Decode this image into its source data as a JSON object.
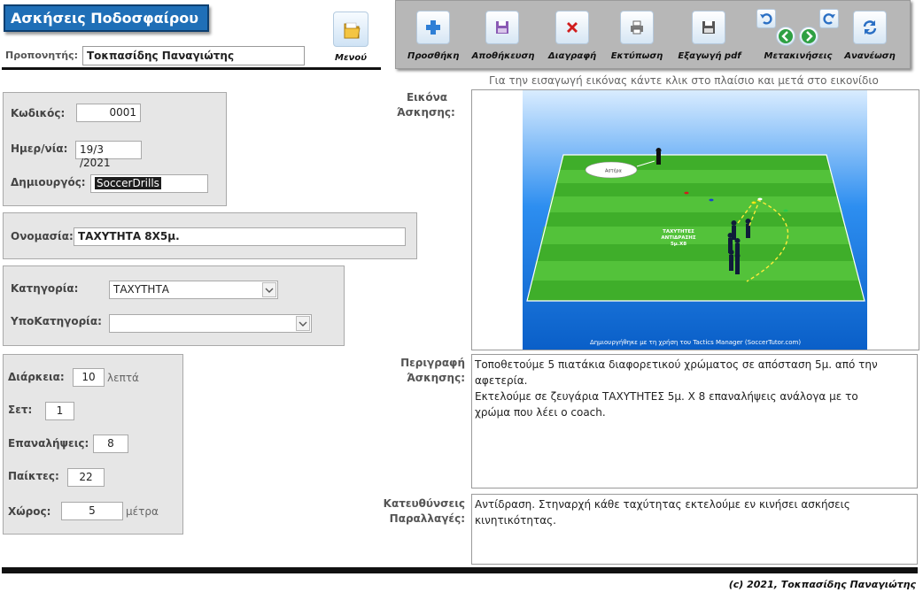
{
  "app": {
    "title": "Ασκήσεις Ποδοσφαίρου"
  },
  "coach": {
    "label": "Προπονητής:",
    "value": "Τοκπασίδης Παναγιώτης"
  },
  "menu": {
    "label": "Μενού"
  },
  "toolbar": {
    "add": "Προσθήκη",
    "save": "Αποθήκευση",
    "delete": "Διαγραφή",
    "print": "Εκτύπωση",
    "export_pdf": "Εξαγωγή pdf",
    "navigation": "Μετακινήσεις",
    "refresh": "Ανανέωση"
  },
  "record": {
    "code_label": "Κωδικός:",
    "code": "0001",
    "date_label": "Ημερ/νία:",
    "date": "19/3 /2021",
    "creator_label": "Δημιουργός:",
    "creator": "SoccerDrills"
  },
  "name": {
    "label": "Ονομασία:",
    "value": "ΤΑΧΥΤΗΤΑ 8Χ5μ."
  },
  "category": {
    "label": "Κατηγορία:",
    "value": "ΤΑΧΥΤΗΤΑ",
    "sub_label": "ΥποΚατηγορία:",
    "sub_value": ""
  },
  "stats": {
    "duration_label": "Διάρκεια:",
    "duration": "10",
    "duration_unit": "λεπτά",
    "sets_label": "Σετ:",
    "sets": "1",
    "reps_label": "Επαναλήψεις:",
    "reps": "8",
    "players_label": "Παίκτες:",
    "players": "22",
    "space_label": "Χώρος:",
    "space": "5",
    "space_unit": "μέτρα"
  },
  "image": {
    "hint": "Για την εισαγωγή εικόνας κάντε κλικ στο πλαίσιο και μετά στο εικονίδιο",
    "label_1": "Εικόνα",
    "label_2": "Άσκησης:",
    "bubble": "Αστέρα",
    "drill_title_1": "ΤΑΧΥΤΗΤΕΣ",
    "drill_title_2": "ΑΝΤΙΔΡΑΣΗΣ",
    "drill_title_3": "5μ.Χ8",
    "credit": "Δημιουργήθηκε με τη χρήση του Tactics Manager (SoccerTutor.com)"
  },
  "description": {
    "label_1": "Περιγραφή",
    "label_2": "Άσκησης:",
    "line_1": "Τοποθετούμε 5 πιατάκια διαφορετικού χρώματος σε απόσταση 5μ. από την",
    "line_2": "αφετερία.",
    "line_3": "Εκτελούμε σε ζευγάρια ΤΑΧΥΤΗΤΕΣ 5μ. Χ 8 επαναλήψεις ανάλογα με το",
    "line_4": "χρώμα που λέει ο coach."
  },
  "directions": {
    "label_1": "Κατευθύνσεις",
    "label_2": "Παραλλαγές:",
    "line_1": "Αντίδραση. Στηναρχή κάθε ταχύτητας εκτελούμε εν κινήσει ασκήσεις",
    "line_2": "κινητικότητας."
  },
  "footer": {
    "copyright": "(c) 2021, Τοκπασίδης Παναγιώτης"
  },
  "colors": {
    "title_bg": "#1f6fb7",
    "pitch": "#3fae2a",
    "sky": "#0a72e0",
    "panel": "#e6e6e6"
  }
}
